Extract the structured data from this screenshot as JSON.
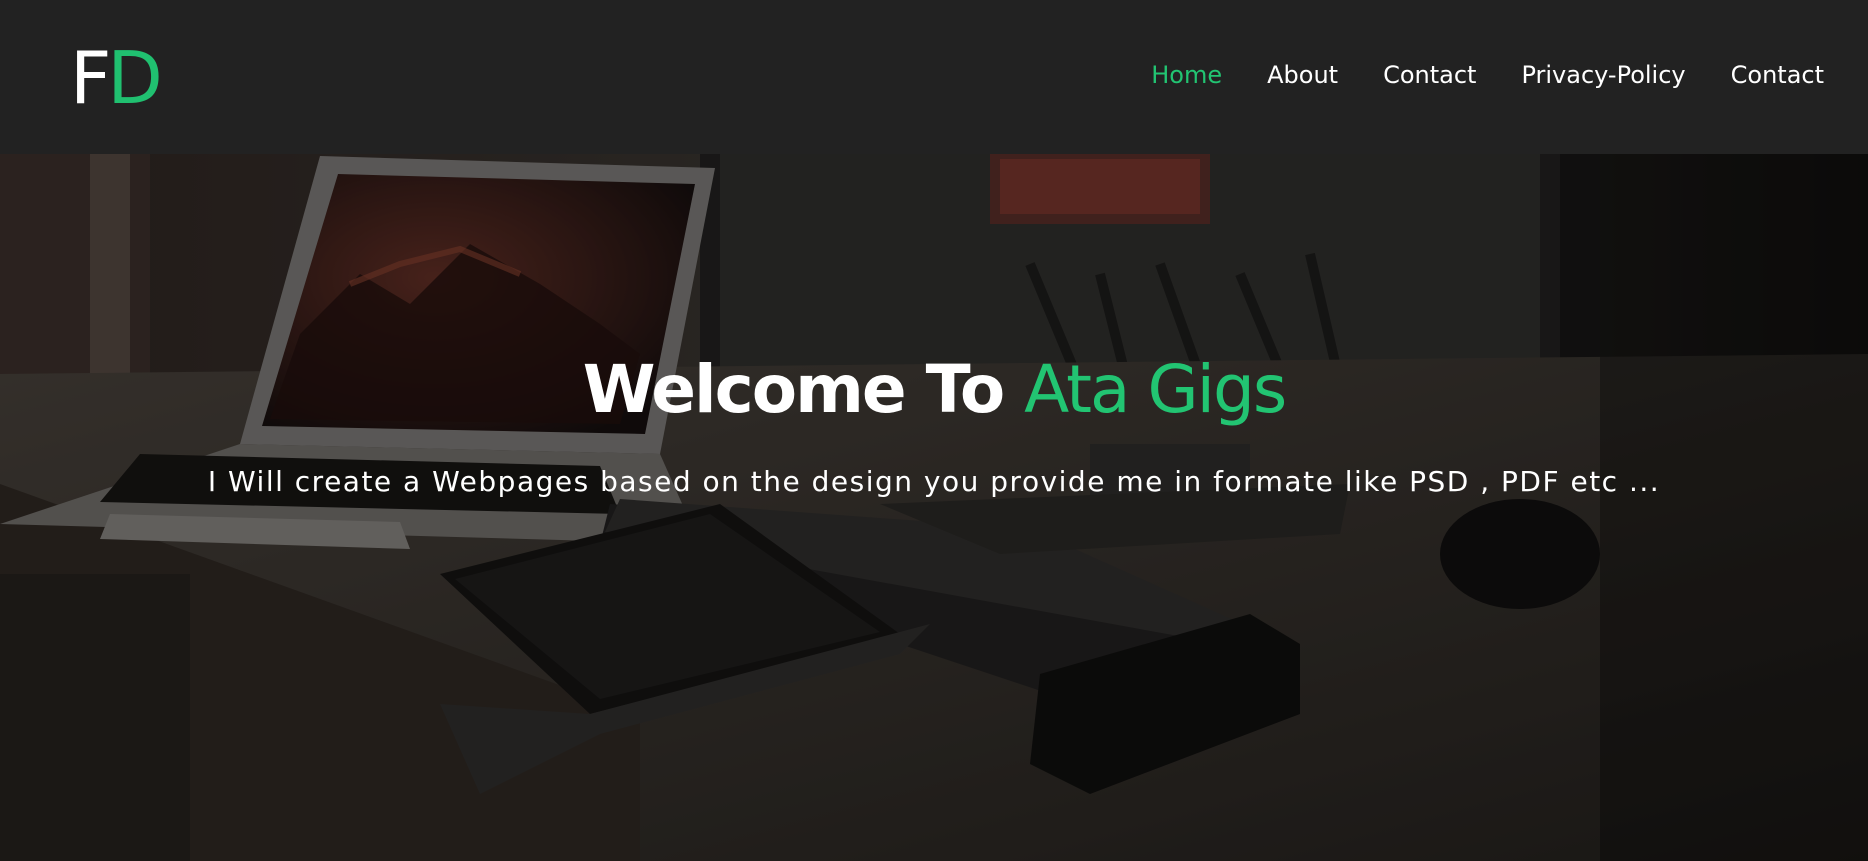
{
  "logo": {
    "part1": "F",
    "part2": "D"
  },
  "nav": {
    "items": [
      {
        "label": "Home",
        "active": true
      },
      {
        "label": "About",
        "active": false
      },
      {
        "label": "Contact",
        "active": false
      },
      {
        "label": "Privacy-Policy",
        "active": false
      },
      {
        "label": "Contact",
        "active": false
      }
    ]
  },
  "hero": {
    "title_prefix": "Welcome To",
    "title_accent": "Ata Gigs",
    "subtitle": "I Will create a Webpages based on the design you provide me in formate like PSD , PDF etc ...",
    "background_image": "desk-workspace-photo"
  },
  "colors": {
    "accent": "#22c472",
    "navbar_bg": "#222222",
    "text": "#ffffff"
  }
}
